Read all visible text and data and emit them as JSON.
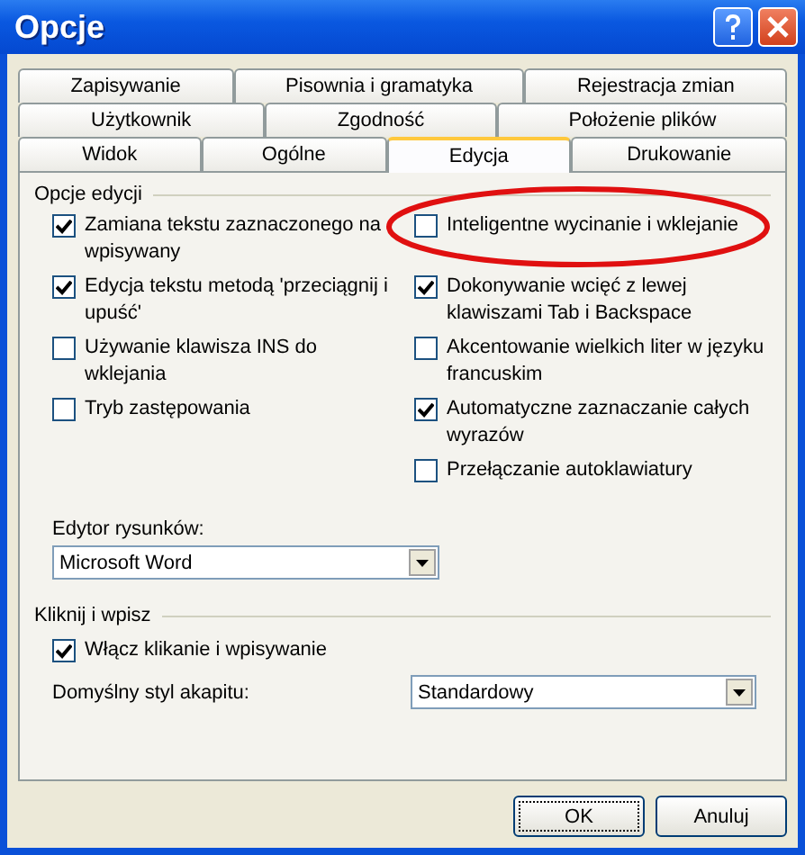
{
  "window": {
    "title": "Opcje"
  },
  "tab_rows": [
    [
      {
        "label": "Zapisywanie",
        "selected": false
      },
      {
        "label": "Pisownia i gramatyka",
        "selected": false
      },
      {
        "label": "Rejestracja zmian",
        "selected": false
      }
    ],
    [
      {
        "label": "Użytkownik",
        "selected": false
      },
      {
        "label": "Zgodność",
        "selected": false
      },
      {
        "label": "Położenie plików",
        "selected": false
      }
    ],
    [
      {
        "label": "Widok",
        "selected": false
      },
      {
        "label": "Ogólne",
        "selected": false
      },
      {
        "label": "Edycja",
        "selected": true
      },
      {
        "label": "Drukowanie",
        "selected": false
      }
    ]
  ],
  "editing_group": {
    "title": "Opcje edycji",
    "left_options": [
      {
        "label": "Zamiana tekstu zaznaczonego na wpisywany",
        "checked": true
      },
      {
        "label": "Edycja tekstu metodą 'przeciągnij i upuść'",
        "checked": true
      },
      {
        "label": "Używanie klawisza INS do wklejania",
        "checked": false
      },
      {
        "label": "Tryb zastępowania",
        "checked": false
      }
    ],
    "right_options": [
      {
        "label": "Inteligentne wycinanie i wklejanie",
        "checked": false
      },
      {
        "label": "Dokonywanie wcięć z lewej klawiszami Tab i Backspace",
        "checked": true
      },
      {
        "label": "Akcentowanie wielkich liter w języku francuskim",
        "checked": false
      },
      {
        "label": "Automatyczne zaznaczanie całych wyrazów",
        "checked": true
      },
      {
        "label": "Przełączanie autoklawiatury",
        "checked": false
      }
    ],
    "picture_editor": {
      "label": "Edytor rysunków:",
      "value": "Microsoft Word"
    }
  },
  "click_group": {
    "title": "Kliknij i wpisz",
    "options": [
      {
        "label": "Włącz klikanie i wpisywanie",
        "checked": true
      }
    ],
    "default_style": {
      "label": "Domyślny styl akapitu:",
      "value": "Standardowy"
    }
  },
  "buttons": [
    {
      "label": "OK",
      "default": true
    },
    {
      "label": "Anuluj",
      "default": false
    }
  ]
}
